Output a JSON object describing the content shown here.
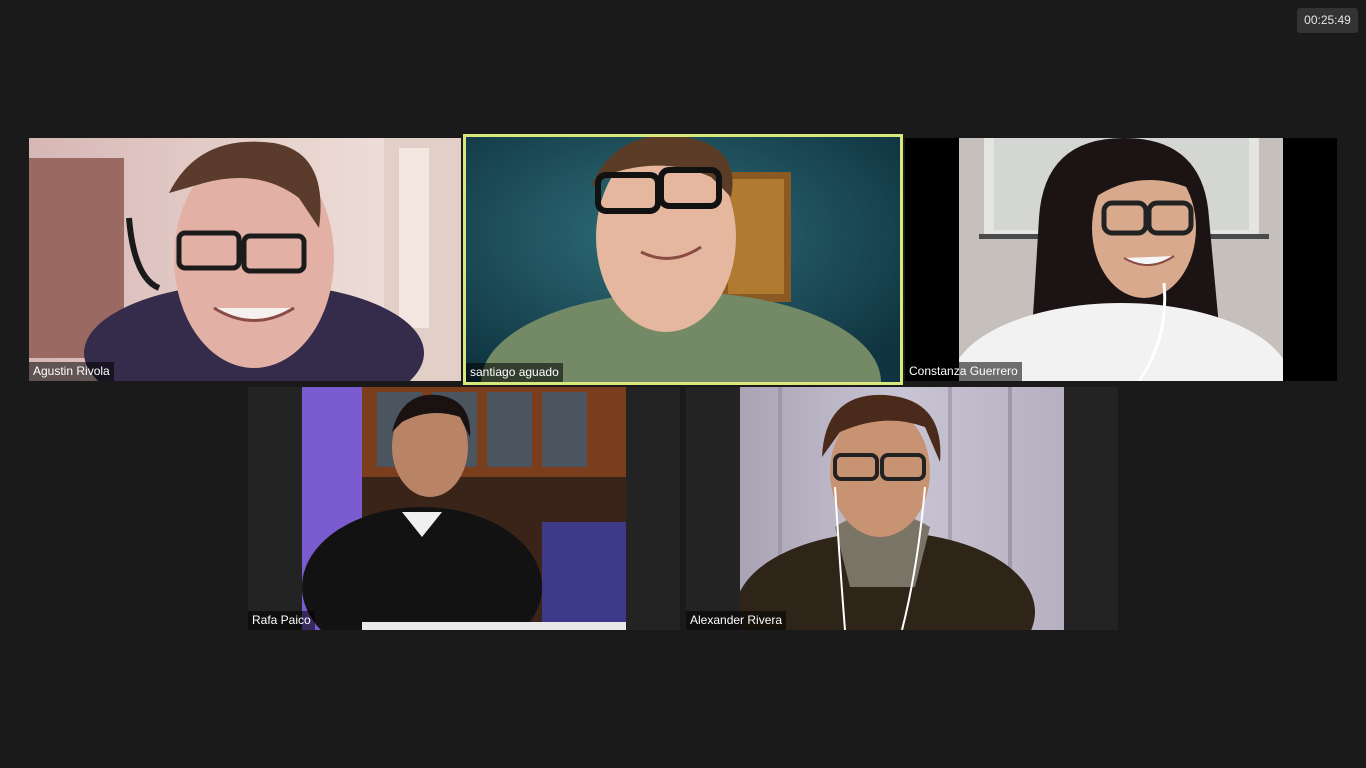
{
  "meeting": {
    "elapsed_time": "00:25:49",
    "active_speaker_border_color": "#d8e87a"
  },
  "participants": [
    {
      "name": "Agustin Rivola",
      "active": false
    },
    {
      "name": "santiago aguado",
      "active": true
    },
    {
      "name": "Constanza Guerrero",
      "active": false
    },
    {
      "name": "Rafa Paico",
      "active": false
    },
    {
      "name": "Alexander Rivera",
      "active": false
    }
  ]
}
